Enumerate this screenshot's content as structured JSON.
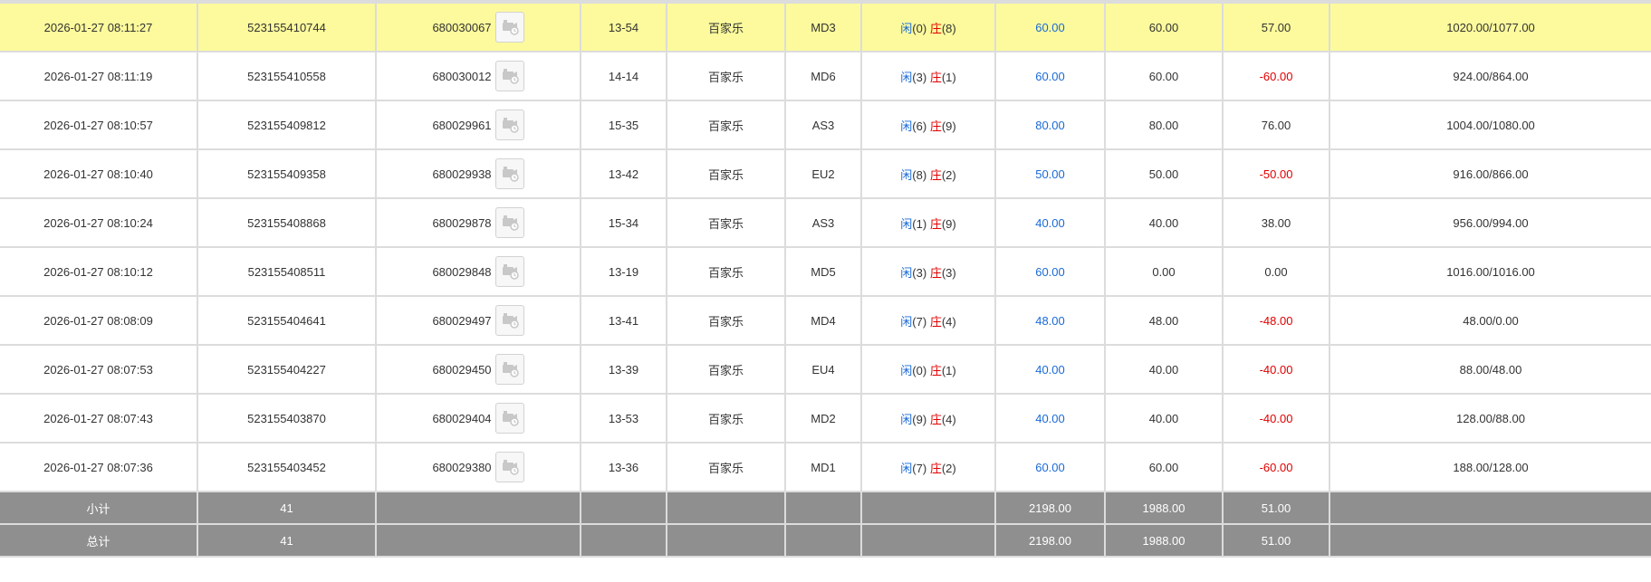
{
  "rows": [
    {
      "time": "2026-01-27 08:11:27",
      "order": "523155410744",
      "round": "680030067",
      "table": "13-54",
      "game": "百家乐",
      "code": "MD3",
      "player_label": "闲",
      "player_score": "(0)",
      "banker_label": "庄",
      "banker_score": "(8)",
      "bet": "60.00",
      "valid": "60.00",
      "win": "57.00",
      "balance": "1020.00/1077.00",
      "win_color": "normal",
      "highlight": true
    },
    {
      "time": "2026-01-27 08:11:19",
      "order": "523155410558",
      "round": "680030012",
      "table": "14-14",
      "game": "百家乐",
      "code": "MD6",
      "player_label": "闲",
      "player_score": "(3)",
      "banker_label": "庄",
      "banker_score": "(1)",
      "bet": "60.00",
      "valid": "60.00",
      "win": "-60.00",
      "balance": "924.00/864.00",
      "win_color": "red",
      "highlight": false
    },
    {
      "time": "2026-01-27 08:10:57",
      "order": "523155409812",
      "round": "680029961",
      "table": "15-35",
      "game": "百家乐",
      "code": "AS3",
      "player_label": "闲",
      "player_score": "(6)",
      "banker_label": "庄",
      "banker_score": "(9)",
      "bet": "80.00",
      "valid": "80.00",
      "win": "76.00",
      "balance": "1004.00/1080.00",
      "win_color": "normal",
      "highlight": false
    },
    {
      "time": "2026-01-27 08:10:40",
      "order": "523155409358",
      "round": "680029938",
      "table": "13-42",
      "game": "百家乐",
      "code": "EU2",
      "player_label": "闲",
      "player_score": "(8)",
      "banker_label": "庄",
      "banker_score": "(2)",
      "bet": "50.00",
      "valid": "50.00",
      "win": "-50.00",
      "balance": "916.00/866.00",
      "win_color": "red",
      "highlight": false
    },
    {
      "time": "2026-01-27 08:10:24",
      "order": "523155408868",
      "round": "680029878",
      "table": "15-34",
      "game": "百家乐",
      "code": "AS3",
      "player_label": "闲",
      "player_score": "(1)",
      "banker_label": "庄",
      "banker_score": "(9)",
      "bet": "40.00",
      "valid": "40.00",
      "win": "38.00",
      "balance": "956.00/994.00",
      "win_color": "normal",
      "highlight": false
    },
    {
      "time": "2026-01-27 08:10:12",
      "order": "523155408511",
      "round": "680029848",
      "table": "13-19",
      "game": "百家乐",
      "code": "MD5",
      "player_label": "闲",
      "player_score": "(3)",
      "banker_label": "庄",
      "banker_score": "(3)",
      "bet": "60.00",
      "valid": "0.00",
      "win": "0.00",
      "balance": "1016.00/1016.00",
      "win_color": "normal",
      "highlight": false
    },
    {
      "time": "2026-01-27 08:08:09",
      "order": "523155404641",
      "round": "680029497",
      "table": "13-41",
      "game": "百家乐",
      "code": "MD4",
      "player_label": "闲",
      "player_score": "(7)",
      "banker_label": "庄",
      "banker_score": "(4)",
      "bet": "48.00",
      "valid": "48.00",
      "win": "-48.00",
      "balance": "48.00/0.00",
      "win_color": "red",
      "highlight": false
    },
    {
      "time": "2026-01-27 08:07:53",
      "order": "523155404227",
      "round": "680029450",
      "table": "13-39",
      "game": "百家乐",
      "code": "EU4",
      "player_label": "闲",
      "player_score": "(0)",
      "banker_label": "庄",
      "banker_score": "(1)",
      "bet": "40.00",
      "valid": "40.00",
      "win": "-40.00",
      "balance": "88.00/48.00",
      "win_color": "red",
      "highlight": false
    },
    {
      "time": "2026-01-27 08:07:43",
      "order": "523155403870",
      "round": "680029404",
      "table": "13-53",
      "game": "百家乐",
      "code": "MD2",
      "player_label": "闲",
      "player_score": "(9)",
      "banker_label": "庄",
      "banker_score": "(4)",
      "bet": "40.00",
      "valid": "40.00",
      "win": "-40.00",
      "balance": "128.00/88.00",
      "win_color": "red",
      "highlight": false
    },
    {
      "time": "2026-01-27 08:07:36",
      "order": "523155403452",
      "round": "680029380",
      "table": "13-36",
      "game": "百家乐",
      "code": "MD1",
      "player_label": "闲",
      "player_score": "(7)",
      "banker_label": "庄",
      "banker_score": "(2)",
      "bet": "60.00",
      "valid": "60.00",
      "win": "-60.00",
      "balance": "188.00/128.00",
      "win_color": "red",
      "highlight": false
    }
  ],
  "subtotal": {
    "label": "小计",
    "count": "41",
    "bet": "2198.00",
    "valid": "1988.00",
    "win": "51.00"
  },
  "total": {
    "label": "总计",
    "count": "41",
    "bet": "2198.00",
    "valid": "1988.00",
    "win": "51.00"
  },
  "colors": {
    "highlight": "#fcfa9c",
    "blue": "#1a6ad6",
    "red": "#e00000",
    "summary_bg": "#8f8f8f",
    "border": "#dcdcdc"
  },
  "icons": {
    "replay": "video-replay-icon"
  }
}
